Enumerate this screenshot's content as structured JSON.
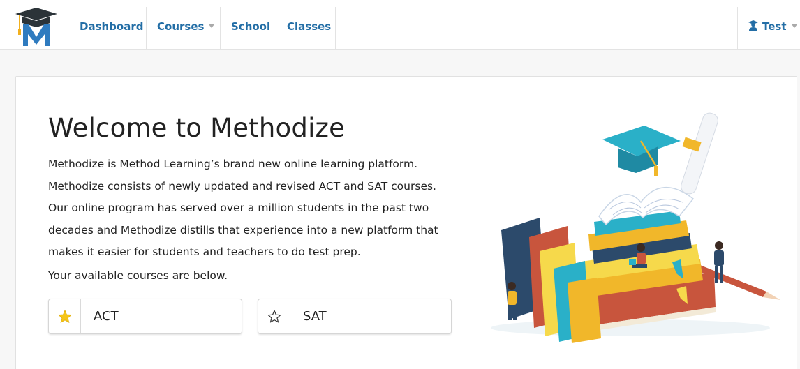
{
  "app": {
    "brand_icon": "methodize-logo"
  },
  "nav": {
    "items": [
      {
        "label": "Dashboard"
      },
      {
        "label": "Courses",
        "has_dropdown": true
      },
      {
        "label": "School"
      },
      {
        "label": "Classes"
      }
    ],
    "user": {
      "label": "Test",
      "icon": "user-graduate-icon",
      "has_dropdown": true
    }
  },
  "welcome": {
    "title": "Welcome to Methodize",
    "description": "Methodize is Method Learning’s brand new online learning platform. Methodize consists of newly updated and revised ACT and SAT courses. Our online program has served over a million students in the past two decades and Methodize distills that experience into a new platform that makes it easier for students and teachers to do test prep.",
    "courses_note": "Your available courses are below."
  },
  "courses": [
    {
      "label": "ACT",
      "icon": "star-filled-icon",
      "starred": true
    },
    {
      "label": "SAT",
      "icon": "star-outline-icon",
      "starred": false
    }
  ],
  "colors": {
    "link": "#236ea6",
    "star": "#f5c518",
    "logo_blue": "#2f7bbf",
    "logo_dark": "#263238"
  }
}
